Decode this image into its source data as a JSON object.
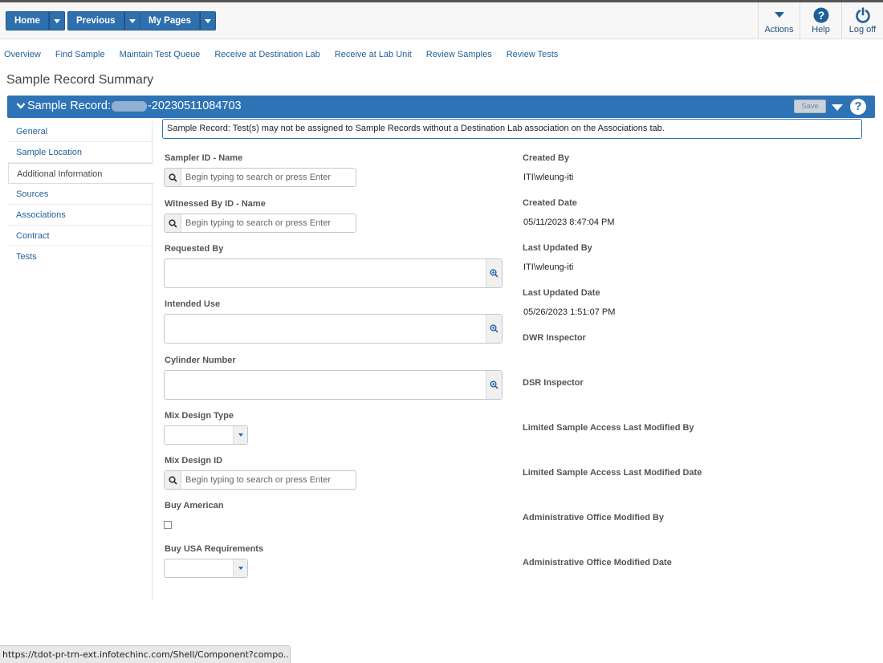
{
  "topbar": {
    "home_label": "Home",
    "previous_label": "Previous",
    "mypages_label": "My Pages",
    "actions_label": "Actions",
    "help_label": "Help",
    "logoff_label": "Log off"
  },
  "nav": {
    "links": [
      "Overview",
      "Find Sample",
      "Maintain Test Queue",
      "Receive at Destination Lab",
      "Receive at Lab Unit",
      "Review Samples",
      "Review Tests"
    ]
  },
  "page_title": "Sample Record Summary",
  "record_bar": {
    "label_prefix": "Sample Record:",
    "record_suffix": "-20230511084703",
    "save_label": "Save",
    "help_glyph": "?"
  },
  "sidebar": {
    "items": [
      "General",
      "Sample Location",
      "Additional Information",
      "Sources",
      "Associations",
      "Contract",
      "Tests"
    ],
    "active": "Additional Information"
  },
  "notice": "Sample Record: Test(s) may not be assigned to Sample Records without a Destination Lab association on the Associations tab.",
  "left_fields": {
    "sampler_label": "Sampler ID - Name",
    "sampler_placeholder": "Begin typing to search or press Enter",
    "witnessed_label": "Witnessed By ID - Name",
    "witnessed_placeholder": "Begin typing to search or press Enter",
    "requested_label": "Requested By",
    "intended_label": "Intended Use",
    "cylinder_label": "Cylinder Number",
    "mixtype_label": "Mix Design Type",
    "mixid_label": "Mix Design ID",
    "mixid_placeholder": "Begin typing to search or press Enter",
    "buyamerican_label": "Buy American",
    "buyusa_label": "Buy USA Requirements"
  },
  "right_fields": {
    "created_by_label": "Created By",
    "created_by_value": "ITI\\wleung-iti",
    "created_date_label": "Created Date",
    "created_date_value": "05/11/2023 8:47:04 PM",
    "updated_by_label": "Last Updated By",
    "updated_by_value": "ITI\\wleung-iti",
    "updated_date_label": "Last Updated Date",
    "updated_date_value": "05/26/2023 1:51:07 PM",
    "dwr_label": "DWR Inspector",
    "dsr_label": "DSR Inspector",
    "lsa_by_label": "Limited Sample Access Last Modified By",
    "lsa_date_label": "Limited Sample Access Last Modified Date",
    "admin_by_label": "Administrative Office Modified By",
    "admin_date_label": "Administrative Office Modified Date"
  },
  "status_url": "https://tdot-pr-trn-ext.infotechinc.com/Shell/Component?compo...",
  "colors": {
    "primary": "#2e73b5",
    "link": "#1f5f9a"
  },
  "icons": [
    "chevron-down-icon",
    "help-circle-icon",
    "power-icon",
    "search-icon",
    "zoom-icon",
    "caret-down-icon"
  ]
}
